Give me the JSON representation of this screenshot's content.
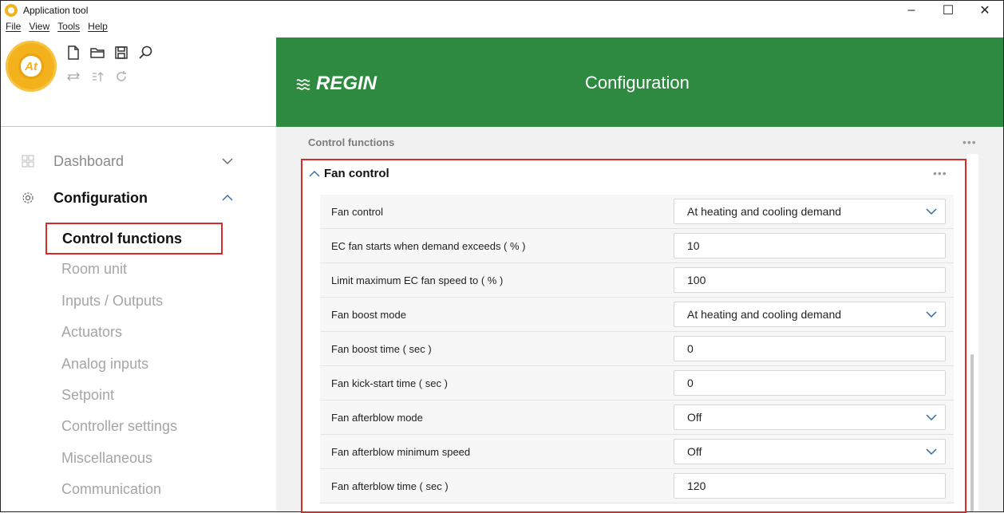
{
  "window": {
    "title": "Application tool",
    "controls": {
      "minimize": "–",
      "maximize": "☐",
      "close": "✕"
    }
  },
  "menu": [
    "File",
    "View",
    "Tools",
    "Help"
  ],
  "logo": {
    "text": "At"
  },
  "toolbar": {
    "row1": [
      "new-file-icon",
      "open-folder-icon",
      "save-icon",
      "search-icon"
    ],
    "row2": [
      "transfer-icon",
      "upload-icon",
      "refresh-icon"
    ]
  },
  "nav": {
    "dashboard": {
      "label": "Dashboard",
      "icon": "grid-icon",
      "expanded": false
    },
    "configuration": {
      "label": "Configuration",
      "icon": "gear-icon",
      "expanded": true
    },
    "items": [
      "Control functions",
      "Room unit",
      "Inputs / Outputs",
      "Actuators",
      "Analog inputs",
      "Setpoint",
      "Controller settings",
      "Miscellaneous",
      "Communication"
    ],
    "active": "Control functions"
  },
  "header": {
    "brand": "REGIN",
    "title": "Configuration",
    "color": "#2e8a40"
  },
  "section": {
    "title": "Control functions",
    "dots": "•••"
  },
  "card": {
    "title": "Fan control",
    "dots": "•••",
    "rows": [
      {
        "label": "Fan control",
        "value": "At heating and cooling demand",
        "dropdown": true
      },
      {
        "label": "EC fan starts when demand exceeds ( % )",
        "value": "10",
        "dropdown": false
      },
      {
        "label": "Limit maximum EC fan speed to ( % )",
        "value": "100",
        "dropdown": false
      },
      {
        "label": "Fan boost mode",
        "value": "At heating and cooling demand",
        "dropdown": true
      },
      {
        "label": "Fan boost time ( sec )",
        "value": "0",
        "dropdown": false
      },
      {
        "label": "Fan kick-start time ( sec )",
        "value": "0",
        "dropdown": false
      },
      {
        "label": "Fan afterblow mode",
        "value": "Off",
        "dropdown": true
      },
      {
        "label": "Fan afterblow minimum speed",
        "value": "Off",
        "dropdown": true
      },
      {
        "label": "Fan afterblow time ( sec )",
        "value": "120",
        "dropdown": false
      }
    ]
  },
  "colors": {
    "accent": "#2e8a40",
    "highlight": "#d62b2b",
    "logo": "#f3b21c"
  }
}
